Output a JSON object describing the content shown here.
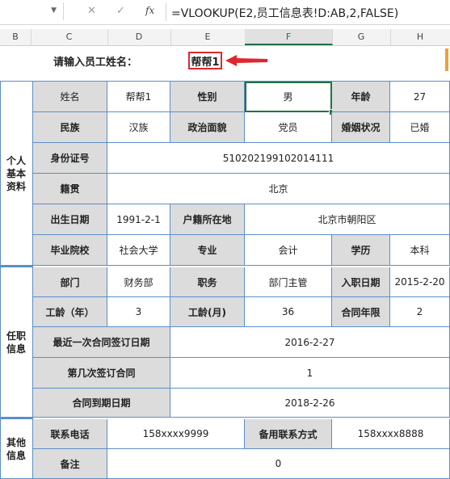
{
  "formula_bar": {
    "formula": "=VLOOKUP(E2,员工信息表!D:AB,2,FALSE)",
    "cancel_icon": "✕",
    "enter_icon": "✓",
    "fx_label": "fx"
  },
  "columns": [
    "B",
    "C",
    "D",
    "E",
    "F",
    "G",
    "H"
  ],
  "header": {
    "prompt": "请输入员工姓名：",
    "name_value": "帮帮1"
  },
  "sections": {
    "basic": "个人基本资料",
    "employment": "任职信息",
    "other": "其他信息"
  },
  "basic": {
    "name_label": "姓名",
    "name": "帮帮1",
    "gender_label": "性别",
    "gender": "男",
    "age_label": "年龄",
    "age": "27",
    "ethnic_label": "民族",
    "ethnic": "汉族",
    "political_label": "政治面貌",
    "political": "党员",
    "marital_label": "婚姻状况",
    "marital": "已婚",
    "id_label": "身份证号",
    "id": "510202199102014111",
    "native_label": "籍贯",
    "native": "北京",
    "birth_label": "出生日期",
    "birth": "1991-2-1",
    "hukou_label": "户籍所在地",
    "hukou": "北京市朝阳区",
    "school_label": "毕业院校",
    "school": "社会大学",
    "major_label": "专业",
    "major": "会计",
    "edu_label": "学历",
    "edu": "本科"
  },
  "employment": {
    "dept_label": "部门",
    "dept": "财务部",
    "title_label": "职务",
    "title": "部门主管",
    "hire_label": "入职日期",
    "hire": "2015-2-20",
    "years_label": "工龄（年）",
    "years": "3",
    "months_label": "工龄(月)",
    "months": "36",
    "term_label": "合同年限",
    "term": "2",
    "last_sign_label": "最近一次合同签订日期",
    "last_sign": "2016-2-27",
    "nth_label": "第几次签订合同",
    "nth": "1",
    "expire_label": "合同到期日期",
    "expire": "2018-2-26"
  },
  "other": {
    "phone_label": "联系电话",
    "phone": "158xxxx9999",
    "alt_label": "备用联系方式",
    "alt": "158xxxx8888",
    "note_label": "备注",
    "note": "0"
  }
}
